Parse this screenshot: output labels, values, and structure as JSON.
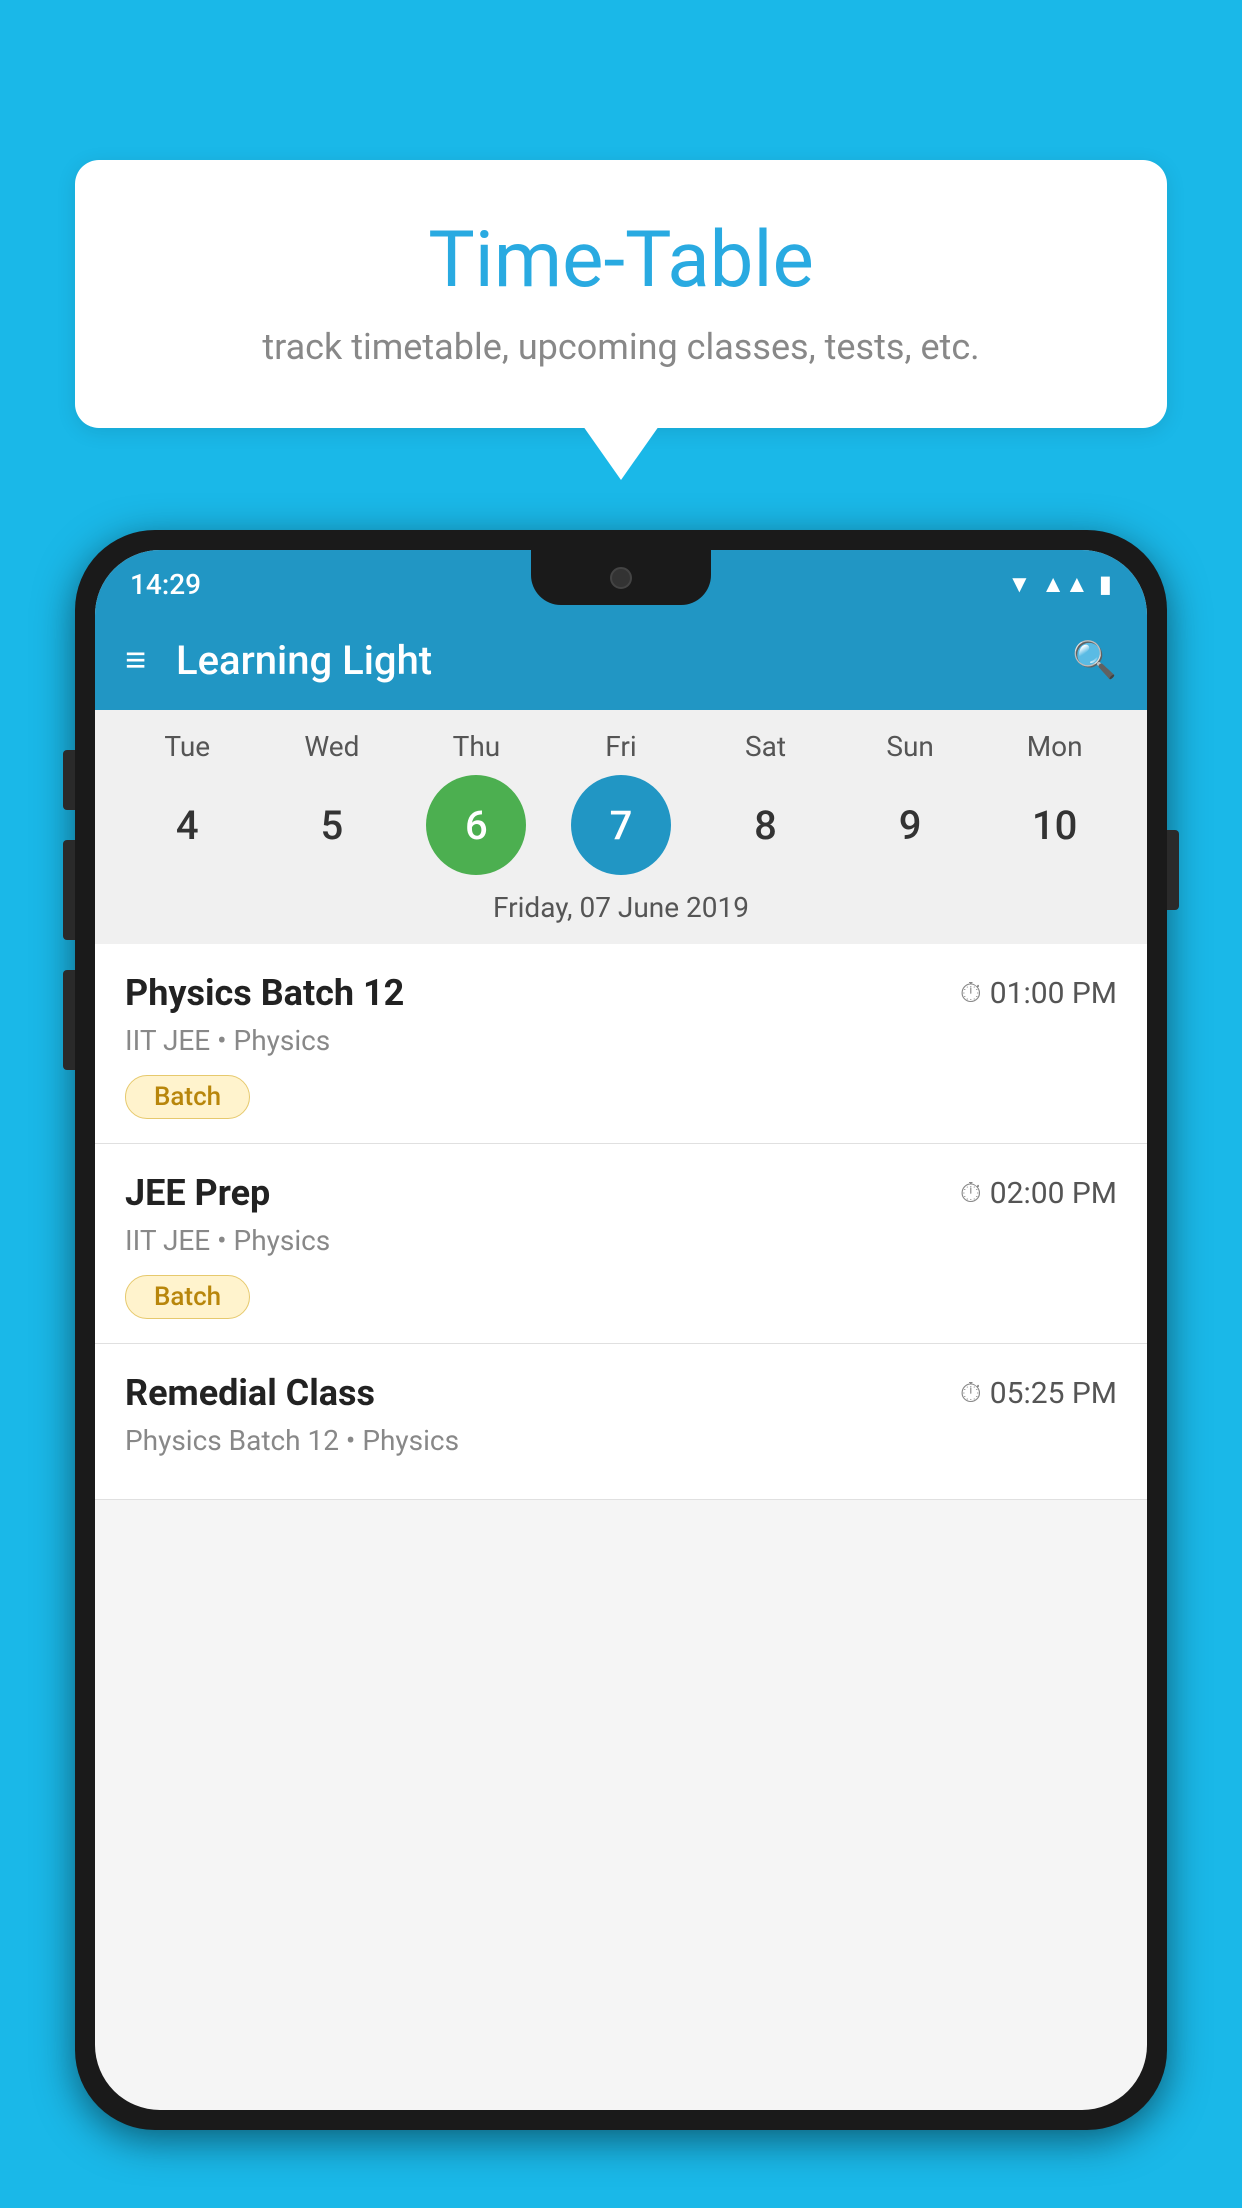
{
  "background_color": "#1ab8e8",
  "bubble": {
    "title": "Time-Table",
    "subtitle": "track timetable, upcoming classes, tests, etc."
  },
  "status_bar": {
    "time": "14:29"
  },
  "app_bar": {
    "title": "Learning Light"
  },
  "calendar": {
    "days": [
      "Tue",
      "Wed",
      "Thu",
      "Fri",
      "Sat",
      "Sun",
      "Mon"
    ],
    "dates": [
      "4",
      "5",
      "6",
      "7",
      "8",
      "9",
      "10"
    ],
    "today_index": 2,
    "selected_index": 3,
    "selected_label": "Friday, 07 June 2019"
  },
  "schedule": [
    {
      "title": "Physics Batch 12",
      "time": "01:00 PM",
      "subtitle": "IIT JEE • Physics",
      "badge": "Batch"
    },
    {
      "title": "JEE Prep",
      "time": "02:00 PM",
      "subtitle": "IIT JEE • Physics",
      "badge": "Batch"
    },
    {
      "title": "Remedial Class",
      "time": "05:25 PM",
      "subtitle": "Physics Batch 12 • Physics",
      "badge": ""
    }
  ]
}
